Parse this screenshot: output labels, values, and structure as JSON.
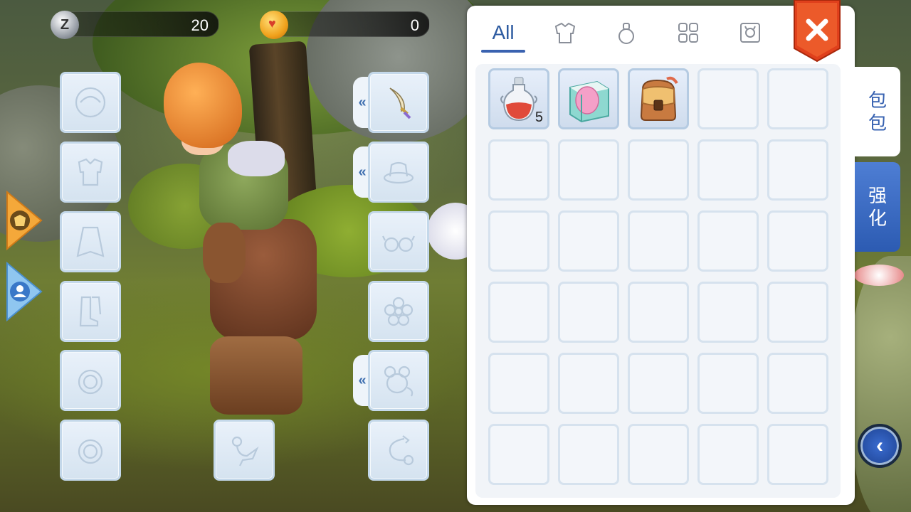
{
  "currency": {
    "zeny": {
      "icon": "zeny-coin-icon",
      "letter": "Z",
      "value": "20"
    },
    "cat_coin": {
      "icon": "cat-coin-icon",
      "value": "0"
    }
  },
  "bag": {
    "tabs": [
      {
        "label": "All",
        "active": true
      },
      {
        "icon": "armor-tab-icon"
      },
      {
        "icon": "potion-tab-icon"
      },
      {
        "icon": "grid-tab-icon"
      },
      {
        "icon": "card-tab-icon"
      }
    ],
    "items": [
      {
        "name": "red-potion",
        "icon": "red-potion-icon",
        "qty": "5"
      },
      {
        "name": "egg-box",
        "icon": "egg-box-icon",
        "qty": ""
      },
      {
        "name": "backpack",
        "icon": "backpack-icon",
        "qty": ""
      }
    ],
    "grid": {
      "columns": 5,
      "rows": 6
    }
  },
  "side_tabs": {
    "bag": "包包",
    "enhance": "强化"
  },
  "equipment_slots": {
    "left": [
      "headgear-slot",
      "armor-slot",
      "cape-slot",
      "boots-slot",
      "ring-slot",
      "ring-slot-2"
    ],
    "right": [
      "weapon-slot",
      "hat-slot",
      "glasses-slot",
      "flower-slot",
      "pet-slot",
      "tail-slot"
    ],
    "mount": "bird-mount-slot"
  },
  "colors": {
    "accent": "#2c5aa0",
    "close": "#e0401c",
    "enhance_tab": "#3a6cc4"
  }
}
